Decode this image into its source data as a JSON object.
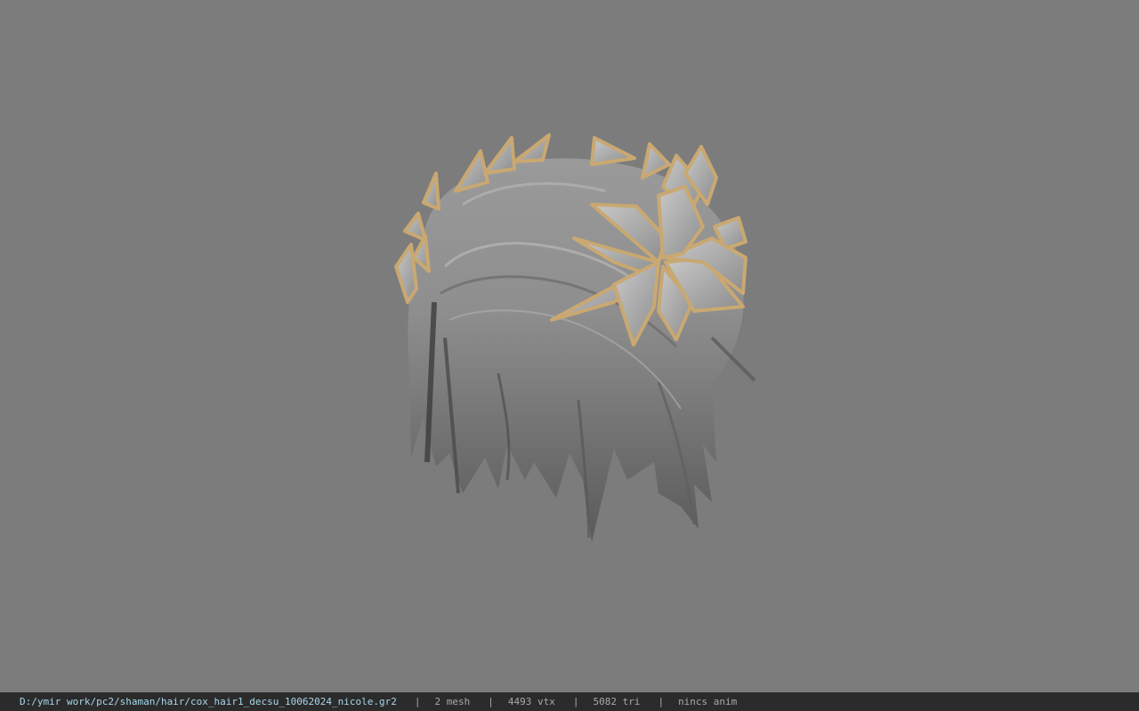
{
  "viewport": {
    "background_color": "#7c7c7c",
    "model_description_icon": "hair-with-laurel-crown-model"
  },
  "statusbar": {
    "file_path": "D:/ymir work/pc2/shaman/hair/cox_hair1_decsu_10062024_nicole.gr2",
    "separator": "|",
    "mesh_count": "2 mesh",
    "vertex_count": "4493 vtx",
    "triangle_count": "5082 tri",
    "anim_status": "nincs anim",
    "path_color": "#a8d7ec",
    "text_color": "#a9a9a9",
    "background_color": "#2b2b2b"
  }
}
